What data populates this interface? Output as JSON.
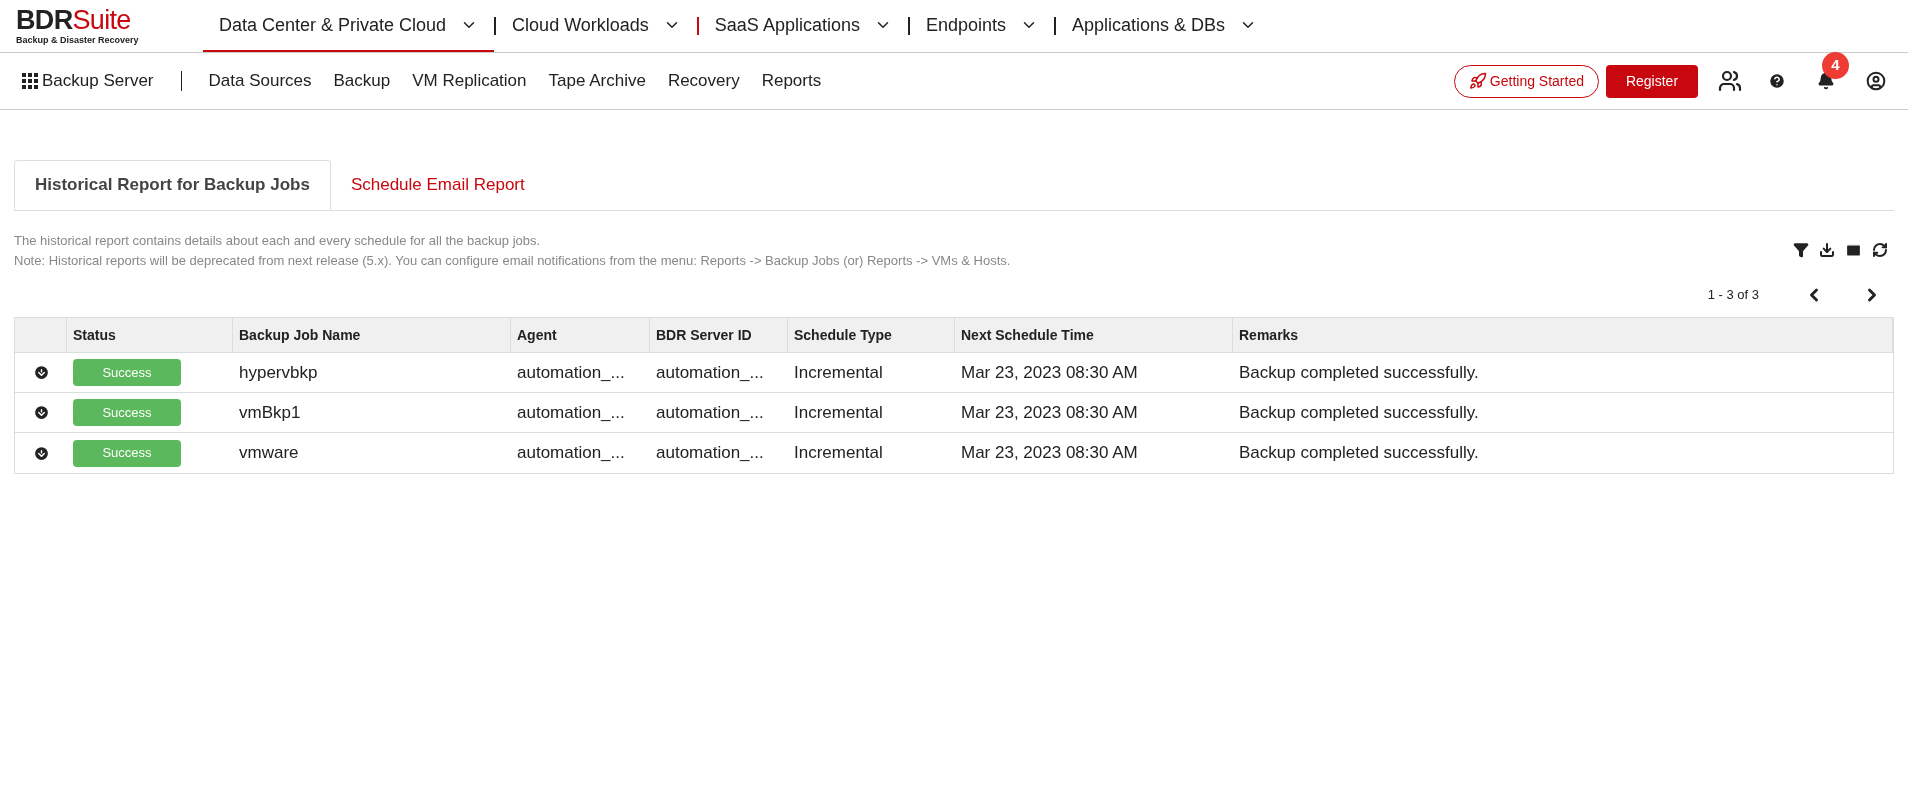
{
  "logo": {
    "brand": "BDR",
    "suffix": "Suite",
    "tagline": "Backup & Disaster Recovery"
  },
  "top_nav": [
    {
      "label": "Data Center & Private Cloud",
      "selected": true
    },
    {
      "label": "Cloud Workloads",
      "selected": false
    },
    {
      "label": "SaaS Applications",
      "selected": false
    },
    {
      "label": "Endpoints",
      "selected": false
    },
    {
      "label": "Applications & DBs",
      "selected": false
    }
  ],
  "sub_nav": {
    "title": "Backup Server",
    "items": [
      "Data Sources",
      "Backup",
      "VM Replication",
      "Tape Archive",
      "Recovery",
      "Reports"
    ]
  },
  "actions": {
    "getting_started": "Getting Started",
    "register": "Register",
    "notification_count": "4"
  },
  "tabs": [
    {
      "label": "Historical Report for Backup Jobs",
      "selected": true
    },
    {
      "label": "Schedule Email Report",
      "selected": false
    }
  ],
  "description": [
    "The historical report contains details about each and every schedule for all the backup jobs.",
    "Note: Historical reports will be deprecated from next release (5.x). You can configure email notifications from the menu: Reports -> Backup Jobs (or) Reports -> VMs & Hosts."
  ],
  "pagination": "1 - 3 of 3",
  "table": {
    "columns": [
      "Status",
      "Backup Job Name",
      "Agent",
      "BDR Server ID",
      "Schedule Type",
      "Next Schedule Time",
      "Remarks"
    ],
    "rows": [
      {
        "status": "Success",
        "color": "#5cb85c",
        "job": "hypervbkp",
        "agent": "automation_...",
        "server": "automation_...",
        "type": "Incremental",
        "next": "Mar 23, 2023 08:30 AM",
        "remarks": "Backup completed successfully."
      },
      {
        "status": "Success",
        "color": "#5cb85c",
        "job": "vmBkp1",
        "agent": "automation_...",
        "server": "automation_...",
        "type": "Incremental",
        "next": "Mar 23, 2023 08:30 AM",
        "remarks": "Backup completed successfully."
      },
      {
        "status": "Success",
        "color": "#5cb85c",
        "job": "vmware",
        "agent": "automation_...",
        "server": "automation_...",
        "type": "Incremental",
        "next": "Mar 23, 2023 08:30 AM",
        "remarks": "Backup completed successfully."
      }
    ]
  }
}
